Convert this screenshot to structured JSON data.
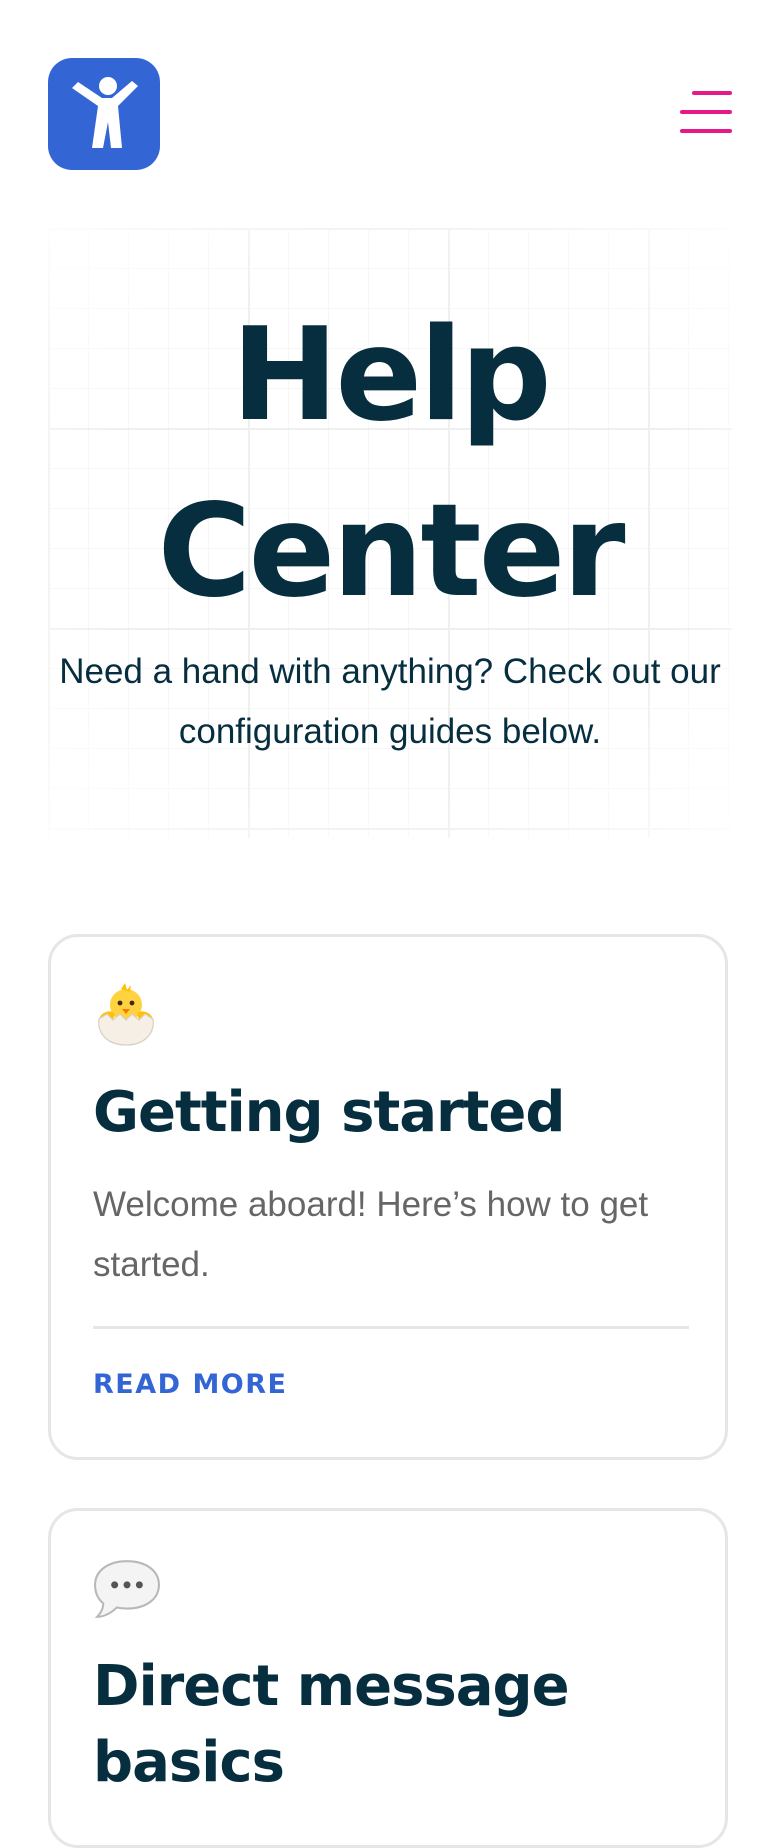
{
  "header": {
    "logo_icon": "accessibility-person-icon",
    "menu_icon": "hamburger-menu-icon",
    "accent_color": "#3366d4",
    "menu_color": "#e6198a"
  },
  "hero": {
    "title": "Help Center",
    "subtitle": "Need a hand with anything? Check out our configuration guides below."
  },
  "cards": [
    {
      "emoji": "🐣",
      "icon": "hatching-chick-icon",
      "title": "Getting started",
      "description": "Welcome aboard! Here’s how to get started.",
      "link_label": "READ MORE"
    },
    {
      "emoji": "💬",
      "icon": "speech-balloon-icon",
      "title": "Direct message basics"
    }
  ]
}
